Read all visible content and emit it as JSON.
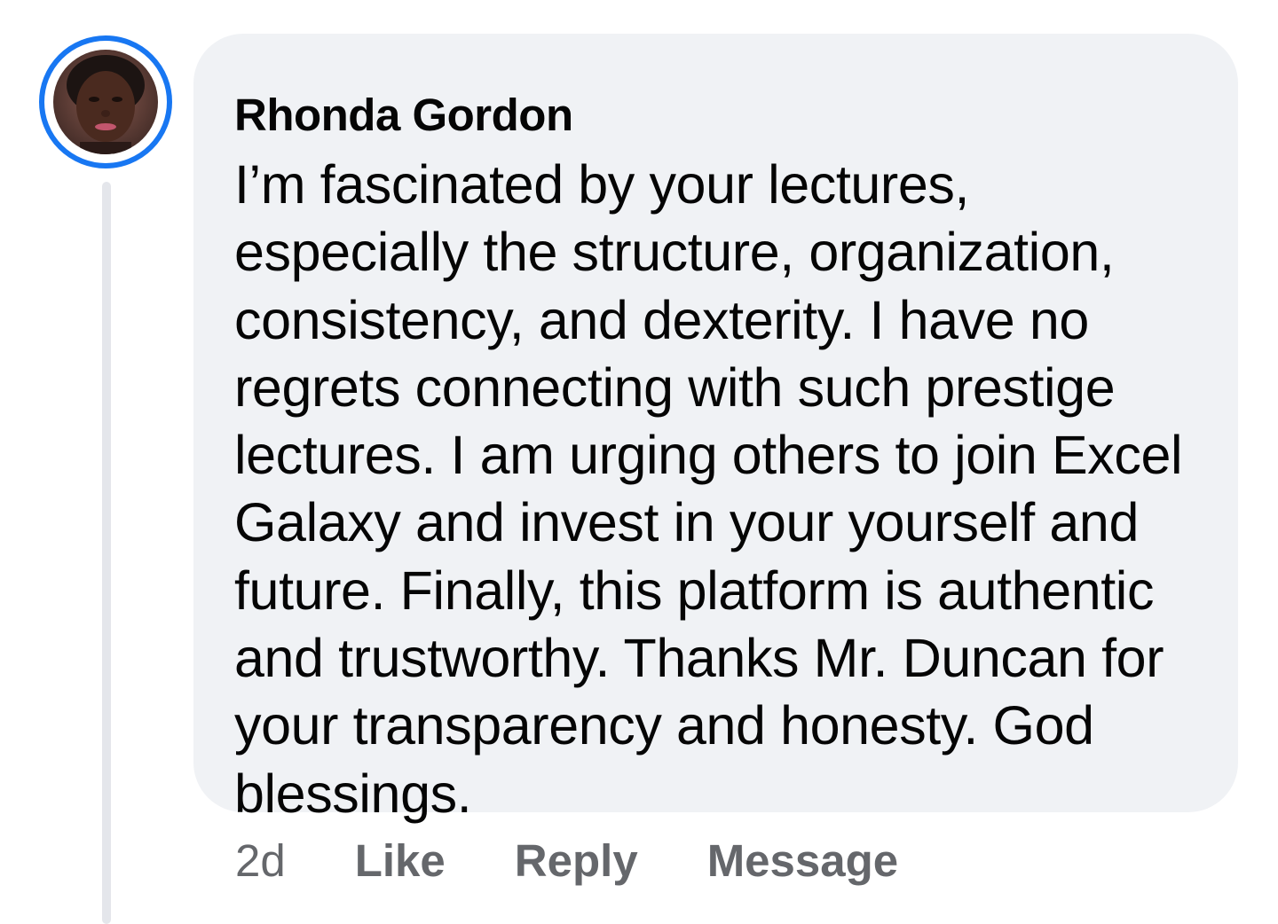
{
  "comment": {
    "author": "Rhonda Gordon",
    "text_lines": [
      "I’m fascinated by your lectures,",
      "especially the structure, organization,",
      "consistency, and dexterity. I have no",
      "regrets connecting with such prestige",
      "lectures. I am urging others to join Excel",
      "Galaxy and invest in your yourself and",
      "future. Finally, this platform is authentic",
      "and trustworthy. Thanks Mr. Duncan for",
      "your transparency and honesty. God",
      "blessings."
    ],
    "time": "2d",
    "actions": {
      "like": "Like",
      "reply": "Reply",
      "message": "Message"
    }
  },
  "colors": {
    "avatar_ring": "#1877f2",
    "bubble_background": "#f0f2f5",
    "text": "#050505",
    "secondary_text": "#65676b",
    "thread_line": "#e4e6eb"
  }
}
